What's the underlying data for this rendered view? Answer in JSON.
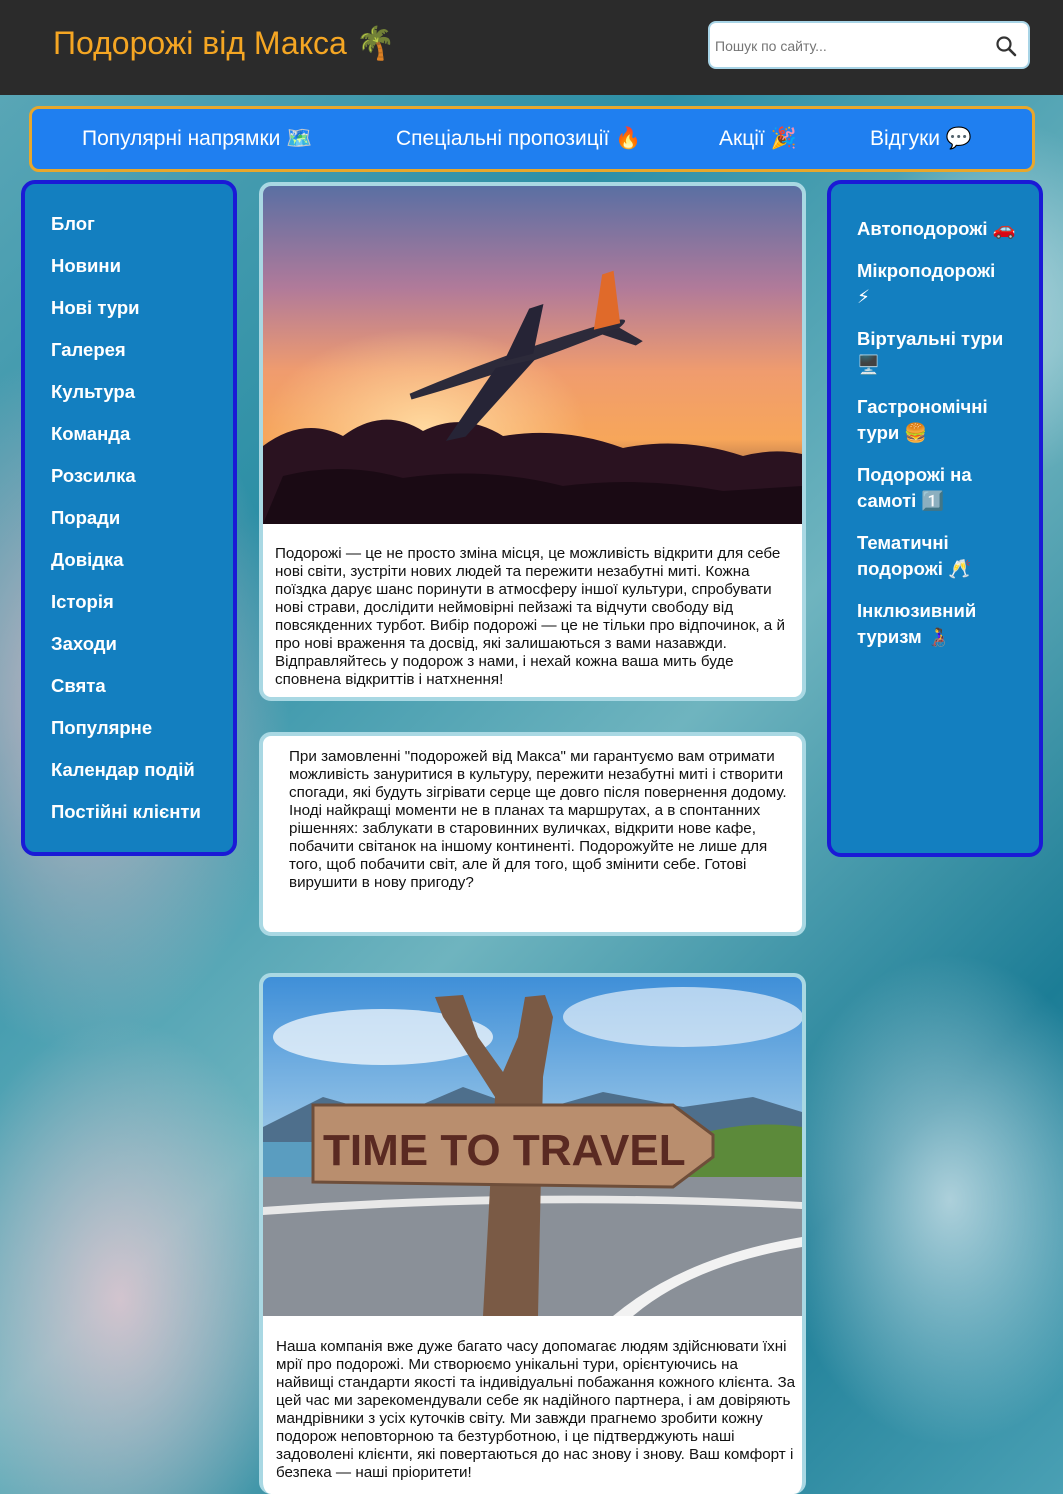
{
  "header": {
    "logo_text": "Подорожі від Макса 🌴",
    "search": {
      "placeholder": "Пошук по сайту..."
    }
  },
  "topnav": {
    "items": [
      {
        "label": "Популярні напрямки 🗺️"
      },
      {
        "label": "Спеціальні пропозиції 🔥"
      },
      {
        "label": "Акції 🎉"
      },
      {
        "label": "Відгуки 💬"
      }
    ]
  },
  "left_sidebar": {
    "items": [
      "Блог",
      "Новини",
      "Нові тури",
      "Галерея",
      "Культура",
      "Команда",
      "Розсилка",
      "Поради",
      "Довідка",
      "Історія",
      "Заходи",
      "Свята",
      "Популярне",
      "Календар подій",
      "Постійні клієнти"
    ]
  },
  "right_sidebar": {
    "items": [
      "Автоподорожі 🚗",
      "Мікроподорожі ⚡",
      "Віртуальні тури 🖥️",
      "Гастрономічні тури 🍔",
      "Подорожі на самоті 1️⃣",
      "Тематичні подорожі 🥂",
      "Інклюзивний туризм 👩‍🦽"
    ]
  },
  "cards": [
    {
      "image_alt": "airplane-at-sunset",
      "text": "Подорожі — це не просто зміна місця, це можливість відкрити для себе нові світи, зустріти нових людей та пережити незабутні миті. Кожна поїздка дарує шанс поринути в атмосферу іншої культури, спробувати нові страви, дослідити неймовірні пейзажі та відчути свободу від повсякденних турбот. Вибір подорожі — це не тільки про відпочинок, а й про нові враження та досвід, які залишаються з вами назавжди. Відправляйтесь у подорож з нами, і нехай кожна ваша мить буде сповнена відкриттів і натхнення!"
    },
    {
      "text": "При замовленні \"подорожей від Макса\" ми гарантуємо вам отримати можливість зануритися в культуру, пережити незабутні миті і створити спогади, які будуть зігрівати серце ще довго після повернення додому. Іноді найкращі моменти не в планах та маршрутах, а в спонтанних рішеннях: заблукати в старовинних вуличках, відкрити нове кафе, побачити світанок на іншому континенті. Подорожуйте не лише для того, щоб побачити світ, але й для того, щоб змінити себе. Готові вирушити в нову пригоду?"
    },
    {
      "image_alt": "time-to-travel-sign",
      "sign_text": "TIME TO TRAVEL",
      "text": "Наша компанія вже дуже багато часу допомагає людям здійснювати їхні мрії про подорожі. Ми створюємо унікальні тури, орієнтуючись на найвищі стандарти якості та індивідуальні побажання кожного клієнта. За цей час ми зарекомендували себе як надійного партнера, і ам довіряють мандрівники з усіх куточків світу. Ми завжди прагнемо зробити кожну подорож неповторною та безтурботною, і це підтверджують наші задоволені клієнти, які повертаються до нас знову і знову. Ваш комфорт і безпека — наші пріоритети!"
    }
  ],
  "colors": {
    "header_bg": "#2b2b2b",
    "logo": "#f5a623",
    "nav_bg": "#1f7ff0",
    "nav_border": "#e8a72c",
    "panel_bg": "#137fc0",
    "panel_border": "#1a1ad6",
    "card_border": "#a9d8e3"
  }
}
